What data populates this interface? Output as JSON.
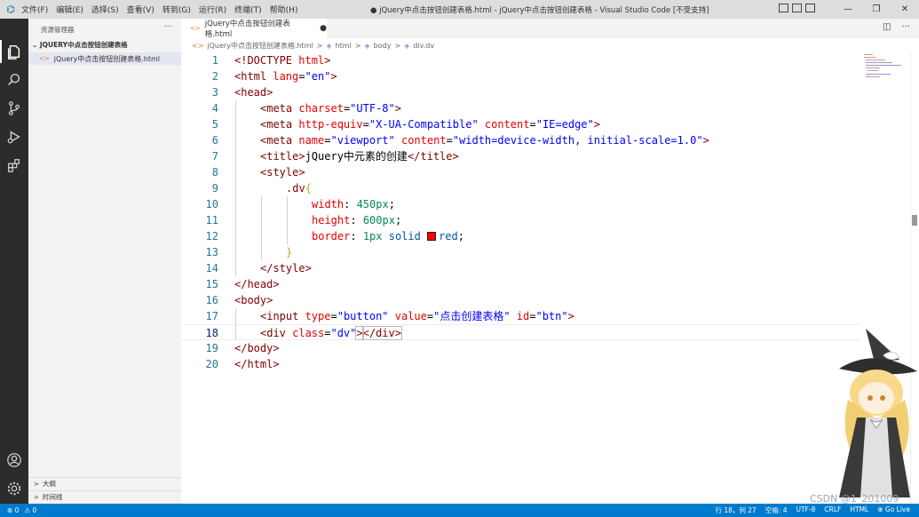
{
  "titlebar": {
    "logo": "⌬",
    "menu": [
      "文件(F)",
      "编辑(E)",
      "选择(S)",
      "查看(V)",
      "转到(G)",
      "运行(R)",
      "终端(T)",
      "帮助(H)"
    ],
    "window_title": "● jQuery中点击按钮创建表格.html - jQuery中点击按钮创建表格 - Visual Studio Code [不受支持]",
    "controls": [
      "—",
      "❐",
      "✕"
    ]
  },
  "sidebar": {
    "header": "资源管理器",
    "more": "···",
    "folder": "⌄ JQUERY中点击按钮创建表格",
    "file": "jQuery中点击按钮创建表格.html",
    "file_icon": "<>",
    "sections": [
      {
        "chevron": ">",
        "label": "大纲"
      },
      {
        "chevron": ">",
        "label": "时间线"
      }
    ]
  },
  "tab": {
    "icon": "<>",
    "label": "jQuery中点击按钮创建表格.html",
    "dirty": "●",
    "split": "◫",
    "more": "···"
  },
  "breadcrumb": {
    "file": "jQuery中点击按钮创建表格.html",
    "sep": ">",
    "html": "html",
    "body": "body",
    "div": "div.dv"
  },
  "editor": {
    "line_numbers": [
      "1",
      "2",
      "3",
      "4",
      "5",
      "6",
      "7",
      "8",
      "9",
      "10",
      "11",
      "12",
      "13",
      "14",
      "15",
      "16",
      "17",
      "18",
      "19",
      "20"
    ],
    "current_line": 18,
    "tokens": {
      "l1_a": "<!DOCTYPE ",
      "l1_b": "html",
      "l1_c": ">",
      "l2_a": "<html ",
      "l2_b": "lang",
      "l2_c": "=",
      "l2_d": "\"en\"",
      "l2_e": ">",
      "l3": "<head>",
      "l4_a": "<meta ",
      "l4_b": "charset",
      "l4_c": "=",
      "l4_d": "\"UTF-8\"",
      "l4_e": ">",
      "l5_a": "<meta ",
      "l5_b": "http-equiv",
      "l5_c": "=",
      "l5_d": "\"X-UA-Compatible\"",
      "l5_e": " ",
      "l5_f": "content",
      "l5_g": "=",
      "l5_h": "\"IE=edge\"",
      "l5_i": ">",
      "l6_a": "<meta ",
      "l6_b": "name",
      "l6_c": "=",
      "l6_d": "\"viewport\"",
      "l6_e": " ",
      "l6_f": "content",
      "l6_g": "=",
      "l6_h": "\"width=device-width, initial-scale=1.0\"",
      "l6_i": ">",
      "l7_a": "<title>",
      "l7_b": "jQuery中元素的创建",
      "l7_c": "</title>",
      "l8": "<style>",
      "l9_a": ".dv",
      "l9_b": "{",
      "l10_a": "width",
      "l10_b": ": ",
      "l10_c": "450px",
      "l10_d": ";",
      "l11_a": "height",
      "l11_b": ": ",
      "l11_c": "600px",
      "l11_d": ";",
      "l12_a": "border",
      "l12_b": ": ",
      "l12_c": "1px",
      "l12_d": " solid ",
      "l12_e": "red",
      "l12_f": ";",
      "l13": "}",
      "l14": "</style>",
      "l15": "</head>",
      "l16": "<body>",
      "l17_a": "<input ",
      "l17_b": "type",
      "l17_c": "=",
      "l17_d": "\"button\"",
      "l17_e": " ",
      "l17_f": "value",
      "l17_g": "=",
      "l17_h": "\"点击创建表格\"",
      "l17_i": " ",
      "l17_j": "id",
      "l17_k": "=",
      "l17_l": "\"btn\"",
      "l17_m": ">",
      "l18_a": "<div ",
      "l18_b": "class",
      "l18_c": "=",
      "l18_d": "\"dv\"",
      "l18_e": ">",
      "l18_f": "</div>",
      "l19": "</body>",
      "l20": "</html>"
    }
  },
  "statusbar": {
    "errors": "⊗ 0",
    "warnings": "⚠ 0",
    "position": "行 18，列 27",
    "spaces": "空格: 4",
    "encoding": "UTF-8",
    "eol": "CRLF",
    "language": "HTML",
    "golive": "⊕ Go Live"
  },
  "watermark": "CSDN @1_201009",
  "colors": {
    "activity_bar": "#2c2c2c",
    "status_bar": "#007acc",
    "sidebar": "#f3f3f3",
    "color_swatch": "#ff0000"
  }
}
